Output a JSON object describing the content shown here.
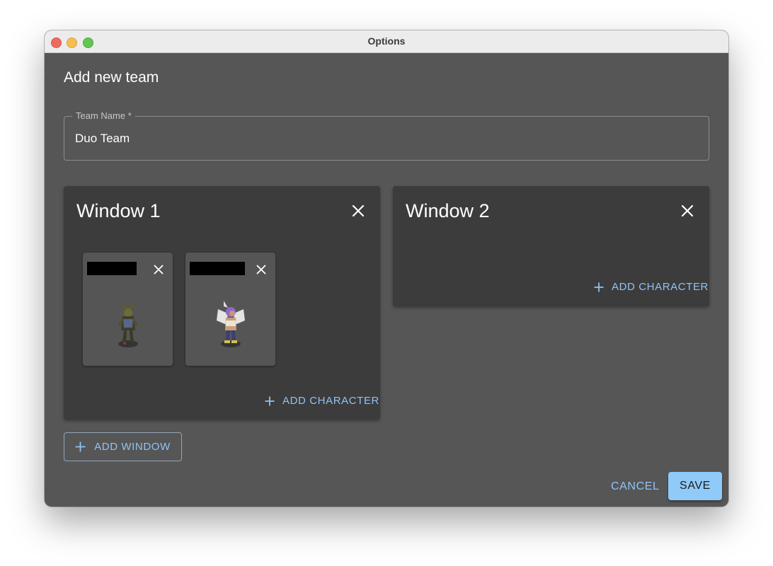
{
  "window": {
    "title": "Options"
  },
  "dialog": {
    "heading": "Add new team",
    "team_name": {
      "label": "Team Name *",
      "value": "Duo Team"
    },
    "windows": [
      {
        "title": "Window 1",
        "add_character_label": "ADD CHARACTER",
        "characters": [
          {
            "icon": "character-sprite-1"
          },
          {
            "icon": "character-sprite-2"
          }
        ]
      },
      {
        "title": "Window 2",
        "add_character_label": "ADD CHARACTER",
        "characters": []
      }
    ],
    "add_window_label": "ADD WINDOW",
    "cancel_label": "CANCEL",
    "save_label": "SAVE"
  },
  "colors": {
    "accent": "#90caf9",
    "dialog_bg": "#565656",
    "card_bg": "#3c3c3c",
    "char_card_bg": "#555555"
  }
}
